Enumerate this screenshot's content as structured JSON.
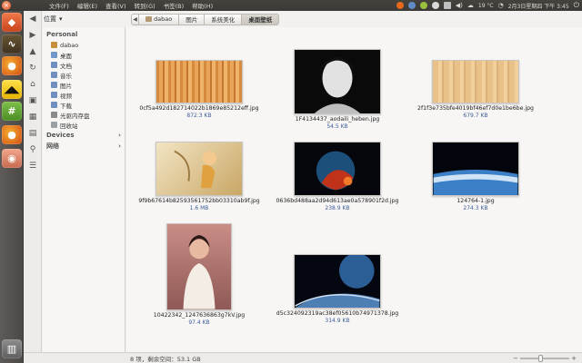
{
  "panel": {
    "close_glyph": "×",
    "menus": [
      "文件(F)",
      "编辑(E)",
      "查看(V)",
      "转到(G)",
      "书签(B)",
      "帮助(H)"
    ],
    "indicators": {
      "temperature": "19 °C",
      "clock": "2月3日星期四 下午 3:45"
    }
  },
  "launcher": {
    "items": [
      {
        "name": "ubuntu-software-icon",
        "color": "#d9502a"
      },
      {
        "name": "system-monitor-icon",
        "color": "#5b4a2f"
      },
      {
        "name": "firefox-icon",
        "color": "#e06a1d"
      },
      {
        "name": "batman-icon",
        "color": "#f2c400"
      },
      {
        "name": "hash-app-icon",
        "color": "#5c9a2e"
      },
      {
        "name": "firefox-icon",
        "color": "#e06a1d"
      },
      {
        "name": "pidgin-icon",
        "color": "#d9876b"
      },
      {
        "name": "trash-icon",
        "color": "#777"
      }
    ]
  },
  "places": {
    "label": "位置",
    "sections": [
      {
        "title": "Personal",
        "items": [
          {
            "label": "dabao",
            "icon": "home"
          },
          {
            "label": "桌面",
            "icon": "desk"
          },
          {
            "label": "文档",
            "icon": "folder"
          },
          {
            "label": "音乐",
            "icon": "folder"
          },
          {
            "label": "图片",
            "icon": "folder"
          },
          {
            "label": "视频",
            "icon": "folder"
          },
          {
            "label": "下载",
            "icon": "folder"
          },
          {
            "label": "光驱内存盘",
            "icon": "drive"
          },
          {
            "label": "回收站",
            "icon": "trash"
          }
        ]
      },
      {
        "title": "Devices",
        "items": []
      },
      {
        "title": "网络",
        "items": []
      }
    ]
  },
  "breadcrumb": [
    "dabao",
    "图片",
    "系统美化",
    "桌面壁纸"
  ],
  "files": [
    {
      "name": "0cf5a492d182714022b1869e85212eff.jpg",
      "size": "872.3 KB",
      "thumb": "wood-vertical"
    },
    {
      "name": "1F4134437_aodaili_heben.jpg",
      "size": "54.5 KB",
      "thumb": "portrait-bw"
    },
    {
      "name": "2f1f3e735bfe4019bf46ef7d0e1be6be.jpg",
      "size": "679.7 KB",
      "thumb": "wood-light"
    },
    {
      "name": "9f9b67614b82593561752bb03310ab9f.jpg",
      "size": "1.6 MB",
      "thumb": "fairy"
    },
    {
      "name": "0636bd488aa2d94d613ae0a578901f2d.jpg",
      "size": "238.9 KB",
      "thumb": "planet-red"
    },
    {
      "name": "124764-1.jpg",
      "size": "274.3 KB",
      "thumb": "earth-horizon"
    },
    {
      "name": "10422342_1247636863g7kV.jpg",
      "size": "97.4 KB",
      "thumb": "portrait-color"
    },
    {
      "name": "d5c324092319ac38ef05610b74971378.jpg",
      "size": "314.9 KB",
      "thumb": "planet-blue"
    }
  ],
  "status": {
    "text": "8 项，剩余空间：53.1 GB",
    "zoom_minus": "−",
    "zoom_plus": "+"
  }
}
